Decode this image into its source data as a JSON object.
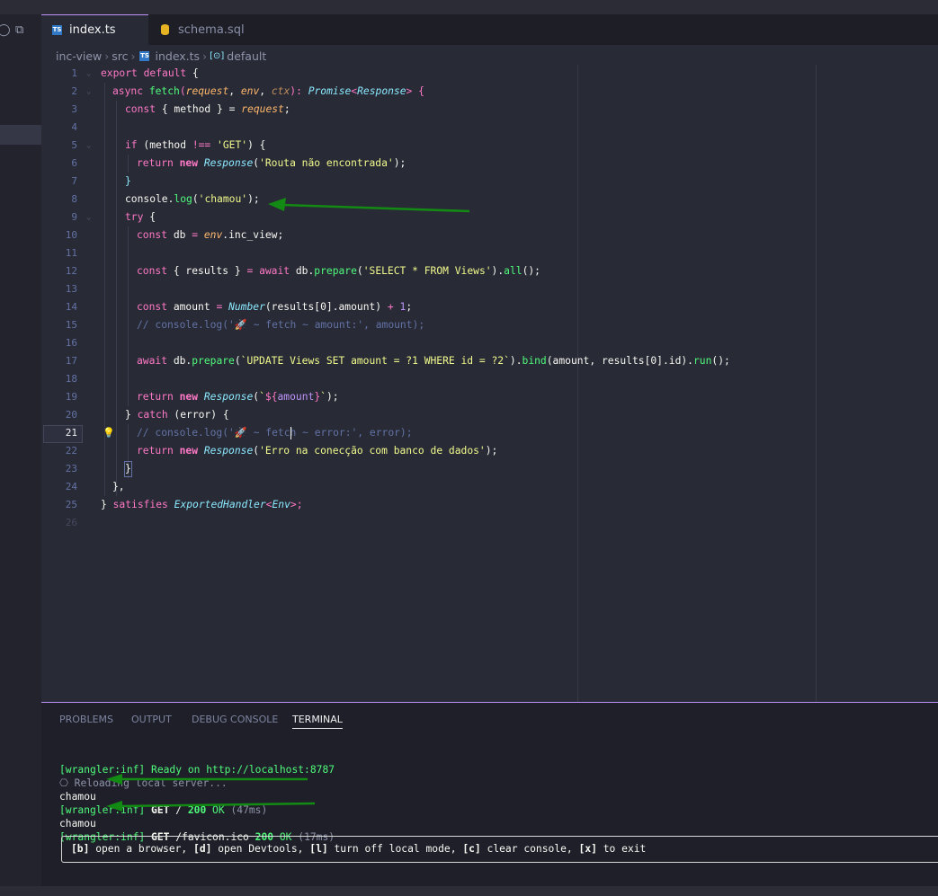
{
  "tabs": [
    {
      "label": "index.ts",
      "icon": "typescript-icon",
      "active": true
    },
    {
      "label": "schema.sql",
      "icon": "database-icon",
      "active": false
    }
  ],
  "breadcrumb": [
    "inc-view",
    "src",
    "index.ts",
    "default"
  ],
  "code": {
    "current_line": 21,
    "lines": [
      {
        "n": "1"
      },
      {
        "n": "2"
      },
      {
        "n": "3"
      },
      {
        "n": "4"
      },
      {
        "n": "5"
      },
      {
        "n": "6"
      },
      {
        "n": "7"
      },
      {
        "n": "8"
      },
      {
        "n": "9"
      },
      {
        "n": "10"
      },
      {
        "n": "11"
      },
      {
        "n": "12"
      },
      {
        "n": "13"
      },
      {
        "n": "14"
      },
      {
        "n": "15"
      },
      {
        "n": "16"
      },
      {
        "n": "17"
      },
      {
        "n": "18"
      },
      {
        "n": "19"
      },
      {
        "n": "20"
      },
      {
        "n": "21"
      },
      {
        "n": "22"
      },
      {
        "n": "23"
      },
      {
        "n": "24"
      },
      {
        "n": "25"
      },
      {
        "n": "26"
      }
    ],
    "text": {
      "l1": [
        "export",
        " default",
        " {"
      ],
      "l2": [
        "async",
        " fetch",
        "(",
        "request",
        ", ",
        "env",
        ", ",
        "ctx",
        "): ",
        "Promise",
        "<",
        "Response",
        "> {"
      ],
      "l3": [
        "const",
        " { method } = ",
        "request",
        ";"
      ],
      "l5": [
        "if",
        " (method ",
        "!==",
        " ",
        "'GET'",
        ") {"
      ],
      "l6": [
        "return",
        " ",
        "new",
        " ",
        "Response",
        "(",
        "'Routa não encontrada'",
        ");"
      ],
      "l7": [
        "}"
      ],
      "l8": [
        "console",
        ".",
        "log",
        "(",
        "'chamou'",
        ");"
      ],
      "l9": [
        "try",
        " {"
      ],
      "l10": [
        "const",
        " db ",
        "=",
        " ",
        "env",
        ".inc_view;"
      ],
      "l12": [
        "const",
        " { results } ",
        "=",
        " ",
        "await",
        " db.",
        "prepare",
        "(",
        "'SELECT * FROM Views'",
        ").",
        "all",
        "();"
      ],
      "l14": [
        "const",
        " amount ",
        "=",
        " ",
        "Number",
        "(results[0].amount) ",
        "+",
        " ",
        "1",
        ";"
      ],
      "l15": [
        "// console.log('🚀 ~ fetch ~ amount:', amount);"
      ],
      "l17": [
        "await",
        " db.",
        "prepare",
        "(",
        "`UPDATE Views SET amount = ?1 WHERE id = ?2`",
        ").",
        "bind",
        "(amount, results[0].id).",
        "run",
        "();"
      ],
      "l19": [
        "return",
        " ",
        "new",
        " ",
        "Response",
        "(",
        "`",
        "${",
        "amount",
        "}",
        "`",
        ");"
      ],
      "l20": [
        "}",
        " catch",
        " (error) {"
      ],
      "l21": [
        "// console.log('🚀 ~ fetch ~ error:', error);"
      ],
      "l22": [
        "return",
        " ",
        "new",
        " ",
        "Response",
        "(",
        "'Erro na conecção com banco de dados'",
        ");"
      ],
      "l23": [
        "}"
      ],
      "l24": [
        "},"
      ],
      "l25": [
        "}",
        " satisfies",
        " ",
        "ExportedHandler",
        "<",
        "Env",
        ">;"
      ]
    }
  },
  "panel": {
    "tabs": [
      "PROBLEMS",
      "OUTPUT",
      "DEBUG CONSOLE",
      "TERMINAL"
    ],
    "active_tab": "TERMINAL",
    "terminal": {
      "l1": "[wrangler:inf] Ready on http://localhost:8787",
      "l2": "⎔ Reloading local server...",
      "l3": "chamou",
      "l4": [
        "[wrangler:inf] ",
        "GET",
        " / ",
        "200",
        " OK ",
        "(47ms)"
      ],
      "l5": "chamou",
      "l6": [
        "[wrangler:inf] ",
        "GET",
        " /favicon.ico ",
        "200",
        " OK ",
        "(17ms)"
      ],
      "hint": [
        "[b]",
        " open a browser, ",
        "[d]",
        " open Devtools, ",
        "[l]",
        " turn off local mode, ",
        "[c]",
        " clear console, ",
        "[x]",
        " to exit"
      ]
    }
  },
  "colors": {
    "arrow": "#138a13",
    "accent": "#bd93f9",
    "background": "#282a36"
  }
}
